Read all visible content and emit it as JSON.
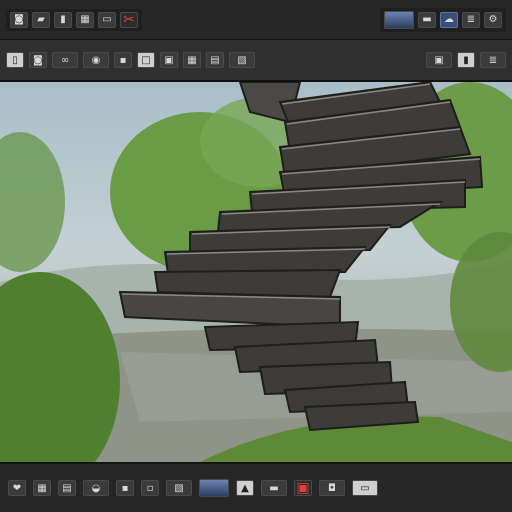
{
  "window": {
    "title": ""
  },
  "toolbar_top": {
    "icons": [
      "camera-icon",
      "flag-icon",
      "dark-square-icon",
      "grid-icon",
      "frame-icon",
      "record-icon",
      "scissors-icon"
    ],
    "right_icons": [
      "image-thumb-icon",
      "folder-icon",
      "cloud-icon",
      "layers-icon",
      "gear-icon"
    ]
  },
  "toolbar_secondary": {
    "icons": [
      "document-icon",
      "camera-icon",
      "link-icon",
      "eye-icon",
      "dark-square-icon",
      "square-icon",
      "frame-icon",
      "grid-icon",
      "box-icon",
      "film-icon"
    ],
    "right_icons": [
      "box-icon",
      "page-icon",
      "layers-icon"
    ]
  },
  "toolbar_bottom": {
    "icons": [
      "heart-icon",
      "grid-icon",
      "grid-icon",
      "shoe-icon",
      "box-icon",
      "box-icon",
      "film-icon",
      "image-thumb-icon",
      "bottle-icon",
      "car-icon",
      "cup-icon",
      "car-icon",
      "panel-icon"
    ]
  },
  "viewport": {
    "scene": "3d-staircase",
    "colors": {
      "sky": "#b4c6cd",
      "foliage": "#5f8a3d",
      "stone": "#3d3c39",
      "ground": "#8f9488"
    }
  }
}
